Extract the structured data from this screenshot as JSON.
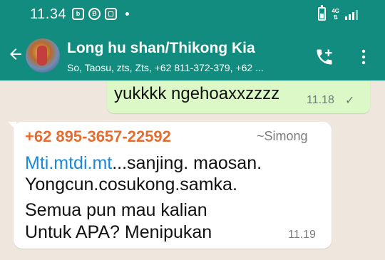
{
  "status_bar": {
    "time": "11.34",
    "net_label": "4G",
    "left_icons": [
      "blogger-icon",
      "b-icon",
      "tv-icon"
    ]
  },
  "header": {
    "title": "Long hu shan/Thikong Kia",
    "subtitle": "So, Taosu, zts, Zts, +62 811-372-379, +62 ...",
    "background": "#128c7e"
  },
  "messages": {
    "outgoing": {
      "text": "yukkkk ngehoaxxzzzz",
      "time": "11.18",
      "status": "✓",
      "bubble_color": "#dcf8c6"
    },
    "incoming": {
      "sender_phone": "+62 895-3657-22592",
      "sender_name": "~Simong",
      "link_text": "Mti.mtdi.mt",
      "line1_rest": "...sanjing. maosan.",
      "line2": "Yongcun.cosukong.samka.",
      "line3": "Semua pun mau kalian",
      "line4": "Untuk APA? Menipukan",
      "time": "11.19",
      "sender_color": "#e46d2f",
      "link_color": "#1d88d4"
    }
  }
}
